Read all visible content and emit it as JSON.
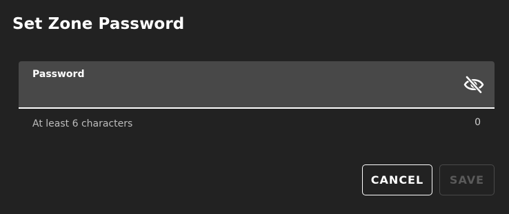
{
  "dialog": {
    "title": "Set Zone Password",
    "password_field": {
      "label": "Password",
      "value": "",
      "visibility_icon": "eye-off-icon",
      "helper_text": "At least 6 characters",
      "char_count": "0"
    },
    "buttons": {
      "cancel_label": "CANCEL",
      "save_label": "SAVE",
      "save_enabled": false
    }
  },
  "colors": {
    "background": "#222222",
    "field_background": "#484848",
    "underline": "#ffffff",
    "disabled_text": "#5a5a5a"
  }
}
